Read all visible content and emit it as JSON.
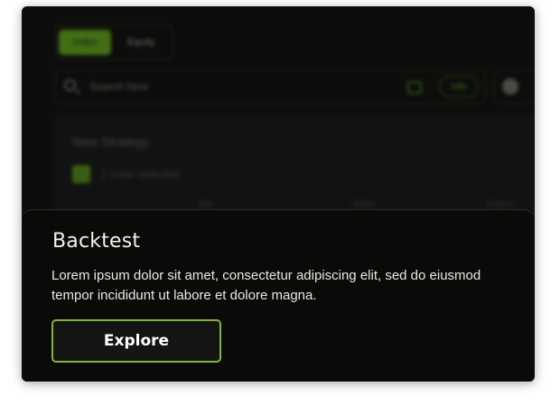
{
  "background": {
    "toggle": {
      "active_label": "Index",
      "inactive_label": "Equity"
    },
    "search": {
      "placeholder": "Search here",
      "chip_label": "Info"
    },
    "panel": {
      "title": "New Strategy",
      "checkbox_label": "1 trade selected",
      "columns": [
        "Qty",
        "Strike",
        "Expiry"
      ]
    }
  },
  "popover": {
    "title": "Backtest",
    "description": "Lorem ipsum dolor sit amet, consectetur adipiscing elit, sed do eiusmod tempor incididunt ut labore et dolore magna.",
    "cta_label": "Explore"
  },
  "colors": {
    "accent_green": "#6fbf1f",
    "cta_border": "#7fb63a",
    "card_bg": "#0d0e0c",
    "popover_bg": "#0a0a08",
    "text_primary": "#f2f2ee"
  }
}
